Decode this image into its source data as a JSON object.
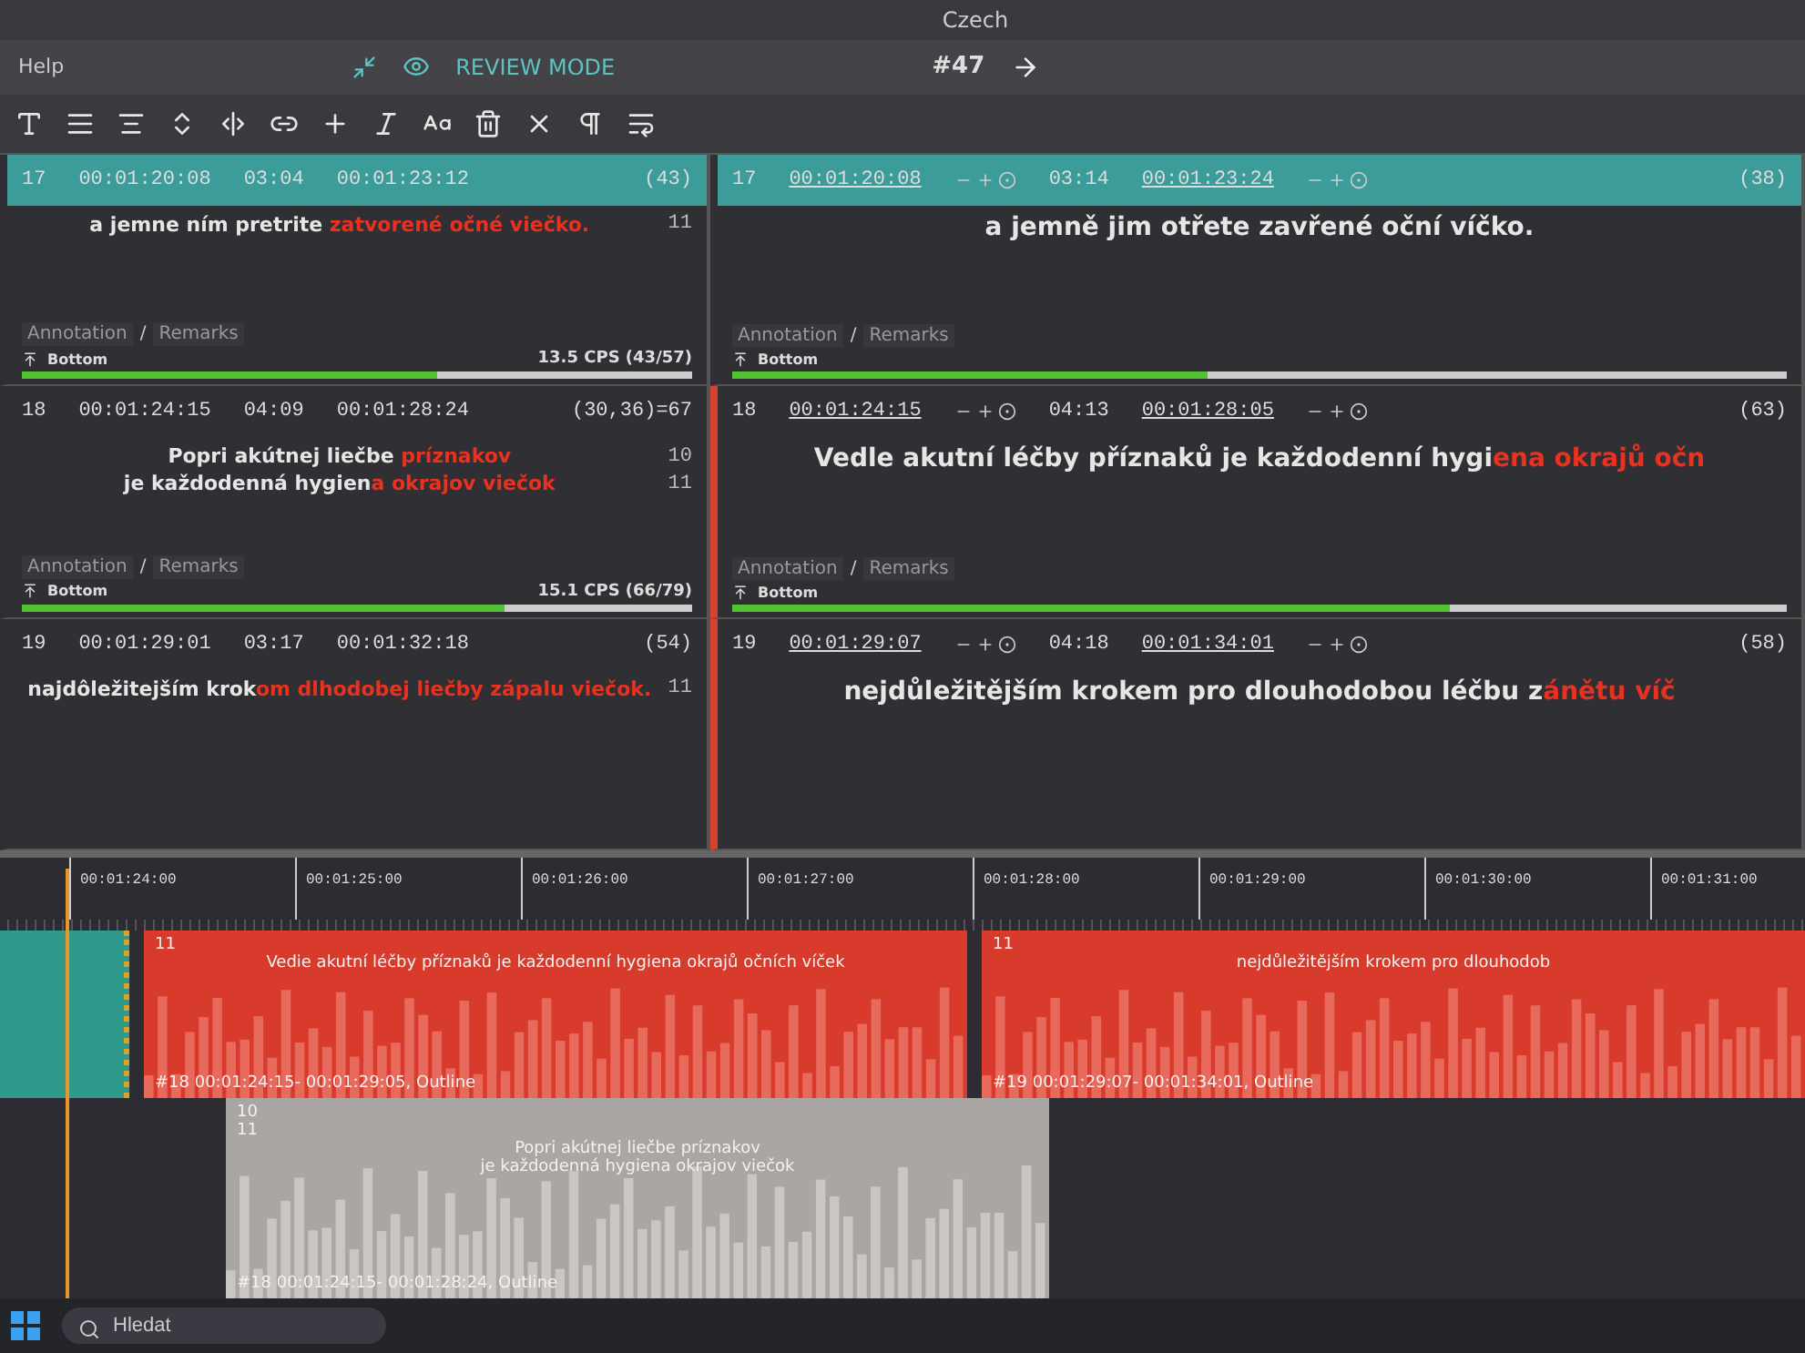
{
  "window": {
    "title": "Czech"
  },
  "menu": [
    "Help"
  ],
  "mode": {
    "label": "REVIEW MODE",
    "on": true
  },
  "counter": "#47",
  "source_rows": [
    {
      "number": "17",
      "start": "00:01:20:08",
      "duration": "03:04",
      "end": "00:01:23:12",
      "count": "(43)",
      "selected": true,
      "lines": [
        {
          "length": "11",
          "segments": [
            {
              "text": "a jemne ním pretrite ",
              "flagged": false
            },
            {
              "text": "zatvorené očné viečko.",
              "flagged": true
            }
          ]
        }
      ],
      "annotation": "Annotation",
      "separator": "/",
      "remarks": "Remarks",
      "position": "Bottom",
      "cps": "13.5 CPS (43/57)",
      "level": 0.62
    },
    {
      "number": "18",
      "start": "00:01:24:15",
      "duration": "04:09",
      "end": "00:01:28:24",
      "count": "(30,36)=67",
      "selected": false,
      "lines": [
        {
          "length": "10",
          "segments": [
            {
              "text": "Popri akútnej liečbe ",
              "flagged": false
            },
            {
              "text": "príznakov",
              "flagged": true
            }
          ]
        },
        {
          "length": "11",
          "segments": [
            {
              "text": "je každodenná hygien",
              "flagged": false
            },
            {
              "text": "a okrajov viečok",
              "flagged": true
            }
          ]
        }
      ],
      "annotation": "Annotation",
      "separator": "/",
      "remarks": "Remarks",
      "position": "Bottom",
      "cps": "15.1 CPS (66/79)",
      "level": 0.72
    },
    {
      "number": "19",
      "start": "00:01:29:01",
      "duration": "03:17",
      "end": "00:01:32:18",
      "count": "(54)",
      "selected": false,
      "lines": [
        {
          "length": "11",
          "segments": [
            {
              "text": "najdôležitejším krok",
              "flagged": false
            },
            {
              "text": "om dlhodobej liečby zápalu viečok.",
              "flagged": true
            }
          ]
        }
      ]
    }
  ],
  "target_rows": [
    {
      "number": "17",
      "start": "00:01:20:08",
      "duration": "03:14",
      "end": "00:01:23:24",
      "count": "(38)",
      "selected": true,
      "marked": false,
      "lines": [
        {
          "segments": [
            {
              "text": "a jemně jim otřete zavřené oční víčko.",
              "flagged": false
            }
          ]
        }
      ],
      "annotation": "Annotation",
      "separator": "/",
      "remarks": "Remarks",
      "position": "Bottom",
      "level": 0.45
    },
    {
      "number": "18",
      "start": "00:01:24:15",
      "duration": "04:13",
      "end": "00:01:28:05",
      "count": "(63)",
      "selected": false,
      "marked": true,
      "lines": [
        {
          "segments": [
            {
              "text": "Vedle akutní léčby příznaků je každodenní hygi",
              "flagged": false
            },
            {
              "text": "ena okrajů očn",
              "flagged": true
            }
          ]
        }
      ],
      "annotation": "Annotation",
      "separator": "/",
      "remarks": "Remarks",
      "position": "Bottom",
      "level": 0.68
    },
    {
      "number": "19",
      "start": "00:01:29:07",
      "duration": "04:18",
      "end": "00:01:34:01",
      "count": "(58)",
      "selected": false,
      "marked": true,
      "lines": [
        {
          "segments": [
            {
              "text": "nejdůležitějším krokem pro dlouhodobou léčbu z",
              "flagged": false
            },
            {
              "text": "ánětu víč",
              "flagged": true
            }
          ]
        }
      ]
    }
  ],
  "timeline": {
    "ticks": [
      "00:01:24:00",
      "00:01:25:00",
      "00:01:26:00",
      "00:01:27:00",
      "00:01:28:00",
      "00:01:29:00",
      "00:01:30:00",
      "00:01:31:00"
    ],
    "lanes": [
      {
        "blocks": [
          {
            "kind": "previous"
          },
          {
            "kind": "target",
            "length": "11",
            "lines": [
              "Vedie akutní léčby příznaků je každodenní hygiena okrajů očních víček"
            ],
            "caption": "#18 00:01:24:15- 00:01:29:05, Outline"
          },
          {
            "kind": "target",
            "length": "11",
            "lines": [
              "nejdůležitějším krokem pro dlouhodob"
            ],
            "caption": "#19 00:01:29:07- 00:01:34:01, Outline"
          }
        ]
      },
      {
        "blocks": [
          {
            "kind": "gap"
          },
          {
            "kind": "source",
            "length": "10",
            "length_2": "11",
            "lines": [
              "Popri akútnej liečbe príznakov",
              "je každodenná hygiena okrajov viečok"
            ],
            "caption": "#18 00:01:24:15- 00:01:28:24, Outline"
          }
        ]
      }
    ]
  },
  "taskbar": {
    "search": {
      "placeholder": "Hledat"
    }
  }
}
